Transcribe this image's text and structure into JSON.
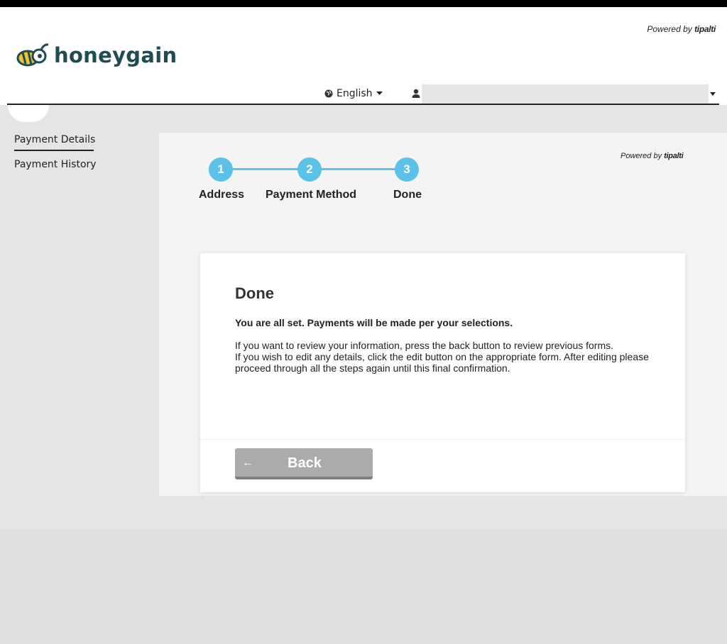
{
  "header": {
    "powered_by": "Powered by",
    "powered_brand": "tipalti",
    "logo_text": "honeygain",
    "language": "English",
    "user_value": ""
  },
  "sidebar": {
    "items": [
      {
        "label": "Payment Details",
        "active": true
      },
      {
        "label": "Payment History",
        "active": false
      }
    ]
  },
  "stepper": {
    "steps": [
      {
        "number": "1",
        "label": "Address"
      },
      {
        "number": "2",
        "label": "Payment Method"
      },
      {
        "number": "3",
        "label": "Done"
      }
    ]
  },
  "card": {
    "powered_by": "Powered by",
    "powered_brand": "tipalti",
    "title": "Done",
    "subtitle": "You are all set. Payments will be made per your selections.",
    "line1": "If you want to review your information, press the back button to review previous forms.",
    "line2": "If you wish to edit any details, click the edit button on the appropriate form. After editing please proceed through all the steps again until this final confirmation.",
    "back_label": "Back"
  },
  "colors": {
    "accent": "#5ac2e8",
    "brand": "#1e4b54",
    "bee_yellow": "#f2c233"
  }
}
